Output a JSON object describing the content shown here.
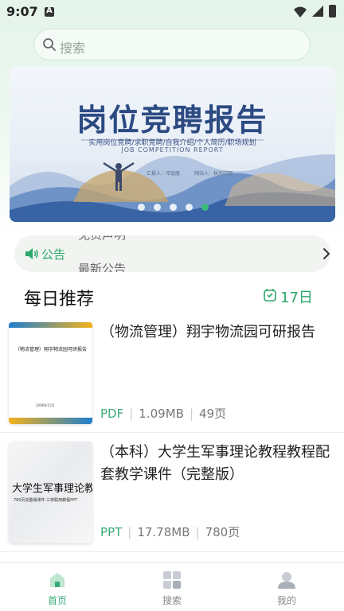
{
  "status_bar": {
    "time": "9:07"
  },
  "search": {
    "placeholder": "搜索"
  },
  "banner": {
    "title": "岗位竞聘报告",
    "subtitle": "实用岗位竞聘/求职竞聘/自我介绍/个人简历/职场规划",
    "english": "JOB COMPETITION REPORT",
    "reporter": "汇报人：叩班度",
    "agency": "网站人：秋天印网",
    "slides": 5,
    "active_slide": 5
  },
  "notice": {
    "label": "公告",
    "scroll_prev": "免责声明",
    "scroll_next": "最新公告"
  },
  "daily": {
    "title": "每日推荐",
    "date": "17日"
  },
  "documents": [
    {
      "title": "（物流管理）翔宇物流园可研报告",
      "type": "PDF",
      "size": "1.09MB",
      "pages": "49页",
      "thumb_text": "（物流管理）翔宇物流园可研报告",
      "thumb_footer": "2006年11月"
    },
    {
      "title": "（本科）大学生军事理论教程教程配套教学课件（完整版）",
      "type": "PPT",
      "size": "17.78MB",
      "pages": "780页",
      "thumb_text": "大学生军事理论教程",
      "thumb_sub": "780页完整版课件·三校联用教程PPT"
    }
  ],
  "bottom_nav": [
    {
      "label": "首页",
      "icon": "home-icon",
      "active": true
    },
    {
      "label": "搜索",
      "icon": "grid-icon",
      "active": false
    },
    {
      "label": "我的",
      "icon": "user-icon",
      "active": false
    }
  ],
  "colors": {
    "accent": "#3aaa78",
    "notice_bg": "#f1f4f1"
  }
}
